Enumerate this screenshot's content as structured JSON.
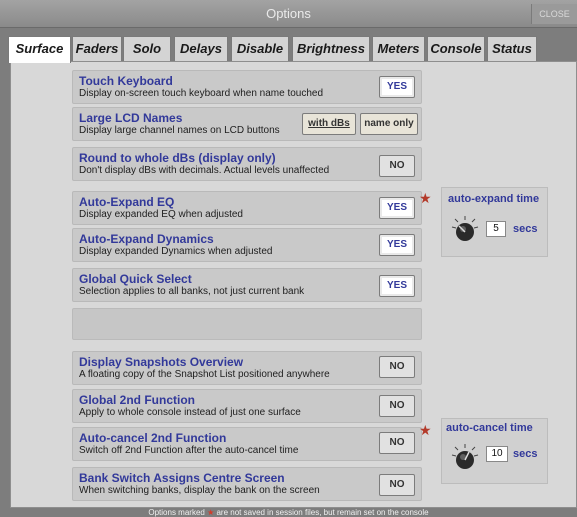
{
  "window": {
    "title": "Options",
    "close_label": "CLOSE"
  },
  "tabs": [
    {
      "label": "Surface",
      "active": true
    },
    {
      "label": "Faders"
    },
    {
      "label": "Solo"
    },
    {
      "label": "Delays"
    },
    {
      "label": "Disable"
    },
    {
      "label": "Brightness"
    },
    {
      "label": "Meters"
    },
    {
      "label": "Console"
    },
    {
      "label": "Status"
    }
  ],
  "options": [
    {
      "title": "Touch Keyboard",
      "desc": "Display on-screen touch keyboard when name touched",
      "value": "YES"
    },
    {
      "title": "Large LCD Names",
      "desc": "Display large channel names on LCD buttons",
      "choices": [
        "with dBs",
        "name only"
      ],
      "selected": "with dBs"
    },
    {
      "title": "Round to whole dBs (display only)",
      "desc": "Don't display dBs with decimals. Actual levels unaffected",
      "value": "NO"
    },
    {
      "title": "Auto-Expand EQ",
      "desc": "Display expanded EQ when adjusted",
      "value": "YES"
    },
    {
      "title": "Auto-Expand Dynamics",
      "desc": "Display expanded Dynamics when adjusted",
      "value": "YES"
    },
    {
      "title": "Global Quick Select",
      "desc": "Selection applies to all banks, not just current bank",
      "value": "YES"
    },
    {
      "title": "Display Snapshots Overview",
      "desc": "A floating copy of the Snapshot List positioned anywhere",
      "value": "NO"
    },
    {
      "title": "Global 2nd Function",
      "desc": "Apply to whole console instead of just one surface",
      "value": "NO"
    },
    {
      "title": "Auto-cancel 2nd Function",
      "desc": "Switch off 2nd Function after the auto-cancel time",
      "value": "NO"
    },
    {
      "title": "Bank Switch Assigns Centre Screen",
      "desc": "When switching banks, display the bank on the screen",
      "value": "NO"
    }
  ],
  "auto_expand_time": {
    "label": "auto-expand time",
    "value": "5",
    "unit": "secs"
  },
  "auto_cancel_time": {
    "label": "auto-cancel time",
    "value": "10",
    "unit": "secs"
  },
  "footer": {
    "before": "Options marked",
    "marker": "★",
    "after": "are not saved in session files, but remain set on the console"
  }
}
